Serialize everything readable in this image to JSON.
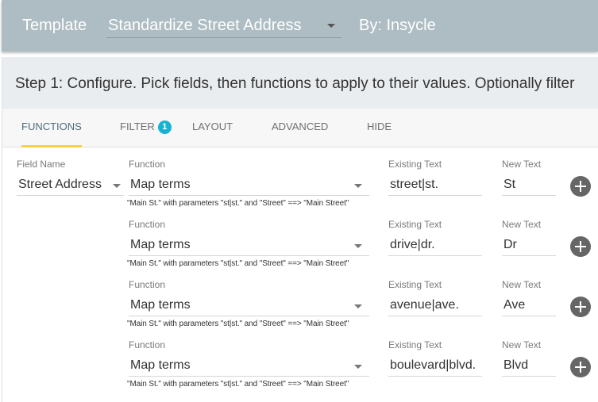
{
  "header": {
    "template_label": "Template",
    "template_value": "Standardize Street Address",
    "by_label": "By: Insycle"
  },
  "step": {
    "text": "Step 1: Configure. Pick fields, then functions to apply to their values. Optionally filter"
  },
  "tabs": [
    {
      "label": "FUNCTIONS",
      "active": true
    },
    {
      "label": "FILTER",
      "badge": "1"
    },
    {
      "label": "LAYOUT"
    },
    {
      "label": "ADVANCED"
    },
    {
      "label": "HIDE"
    }
  ],
  "field_name": {
    "label": "Field Name",
    "value": "Street Address"
  },
  "rows": [
    {
      "function_label": "Function",
      "function_value": "Map terms",
      "hint": "\"Main St.\" with parameters \"st|st.\" and \"Street\" ==> \"Main Street\"",
      "existing_label": "Existing Text",
      "existing_value": "street|st.",
      "new_label": "New Text",
      "new_value": "St"
    },
    {
      "function_label": "Function",
      "function_value": "Map terms",
      "hint": "\"Main St.\" with parameters \"st|st.\" and \"Street\" ==> \"Main Street\"",
      "existing_label": "Existing Text",
      "existing_value": "drive|dr.",
      "new_label": "New Text",
      "new_value": "Dr"
    },
    {
      "function_label": "Function",
      "function_value": "Map terms",
      "hint": "\"Main St.\" with parameters \"st|st.\" and \"Street\" ==> \"Main Street\"",
      "existing_label": "Existing Text",
      "existing_value": "avenue|ave.",
      "new_label": "New Text",
      "new_value": "Ave"
    },
    {
      "function_label": "Function",
      "function_value": "Map terms",
      "hint": "\"Main St.\" with parameters \"st|st.\" and \"Street\" ==> \"Main Street\"",
      "existing_label": "Existing Text",
      "existing_value": "boulevard|blvd.",
      "new_label": "New Text",
      "new_value": "Blvd"
    }
  ],
  "colors": {
    "header_bg": "#aebcc3",
    "step_bg": "#eaedf0",
    "tab_indicator": "#f6d14a",
    "badge": "#17b2d3",
    "add_button": "#666666"
  }
}
